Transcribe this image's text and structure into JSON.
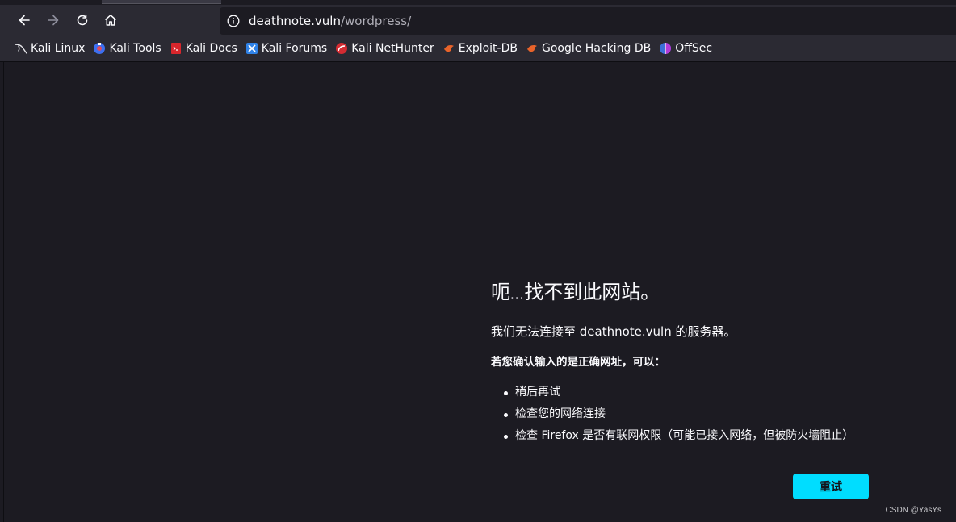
{
  "browser": {
    "url_host": "deathnote.vuln",
    "url_path": "/wordpress/"
  },
  "bookmarks": [
    {
      "label": "Kali Linux",
      "icon": "kali-dragon-icon"
    },
    {
      "label": "Kali Tools",
      "icon": "kali-tools-icon"
    },
    {
      "label": "Kali Docs",
      "icon": "kali-docs-icon"
    },
    {
      "label": "Kali Forums",
      "icon": "kali-forums-icon"
    },
    {
      "label": "Kali NetHunter",
      "icon": "nethunter-icon"
    },
    {
      "label": "Exploit-DB",
      "icon": "exploit-db-icon"
    },
    {
      "label": "Google Hacking DB",
      "icon": "ghdb-icon"
    },
    {
      "label": "OffSec",
      "icon": "offsec-icon"
    }
  ],
  "error": {
    "title_a": "呃",
    "title_dots": "...",
    "title_b": "找不到此网站。",
    "description": "我们无法连接至 deathnote.vuln 的服务器。",
    "suggest_heading": "若您确认输入的是正确网址，可以：",
    "suggestions": [
      "稍后再试",
      "检查您的网络连接",
      "检查 Firefox 是否有联网权限（可能已接入网络，但被防火墙阻止）"
    ],
    "retry_label": "重试"
  },
  "watermark": "CSDN @YasYs",
  "colors": {
    "accent": "#00ddff",
    "background": "#1c1b22",
    "toolbar": "#2b2a33"
  }
}
